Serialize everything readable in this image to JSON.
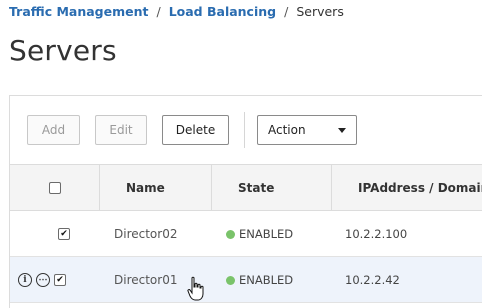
{
  "breadcrumb": {
    "items": [
      "Traffic Management",
      "Load Balancing"
    ],
    "current": "Servers",
    "separator": "/"
  },
  "page": {
    "title": "Servers"
  },
  "toolbar": {
    "add_label": "Add",
    "edit_label": "Edit",
    "delete_label": "Delete",
    "action_label": "Action"
  },
  "table": {
    "columns": [
      "Name",
      "State",
      "IPAddress / Domain"
    ],
    "rows": [
      {
        "name": "Director02",
        "state": "ENABLED",
        "ip": "10.2.2.100",
        "checked": true
      },
      {
        "name": "Director01",
        "state": "ENABLED",
        "ip": "10.2.2.42",
        "checked": true
      }
    ]
  },
  "colors": {
    "link": "#2a6cb0",
    "enabled_dot": "#7ac36a",
    "selected_row": "#eef3fb"
  },
  "icons": [
    "info-icon",
    "more-icon",
    "hand-cursor-icon",
    "caret-down-icon"
  ]
}
